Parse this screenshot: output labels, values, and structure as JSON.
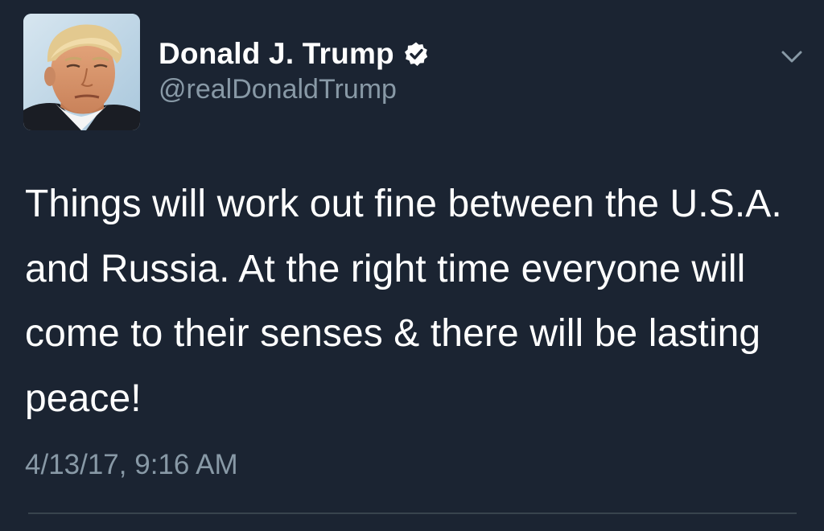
{
  "tweet": {
    "author": {
      "display_name": "Donald J. Trump",
      "handle": "@realDonaldTrump",
      "verified": true,
      "avatar_icon": "profile-photo"
    },
    "text": "Things will work out fine between the U.S.A. and Russia. At the right time everyone will come to their senses & there will be lasting peace!",
    "timestamp": "4/13/17, 9:16 AM",
    "menu_icon": "chevron-down-icon"
  },
  "colors": {
    "background": "#1b2432",
    "text": "#ffffff",
    "secondary_text": "#8899a6",
    "divider": "#38444d"
  }
}
